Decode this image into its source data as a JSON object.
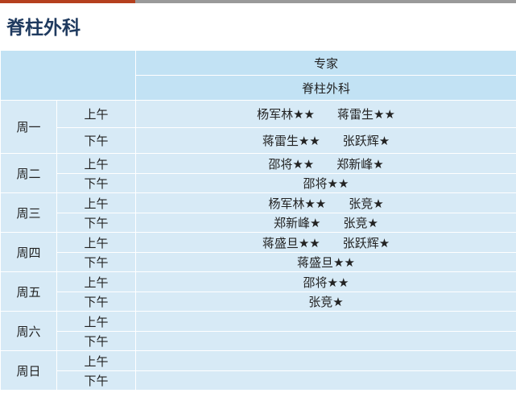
{
  "title": "脊柱外科",
  "header": {
    "experts_label": "专家",
    "dept_label": "脊柱外科"
  },
  "schedule": [
    {
      "day": "周一",
      "am": {
        "label": "上午",
        "doctors": [
          "杨军林★★",
          "蒋雷生★★"
        ]
      },
      "pm": {
        "label": "下午",
        "doctors": [
          "蒋雷生★★",
          "张跃辉★"
        ]
      }
    },
    {
      "day": "周二",
      "am": {
        "label": "上午",
        "doctors": [
          "邵将★★",
          "郑新峰★"
        ]
      },
      "pm": {
        "label": "下午",
        "doctors": [
          "邵将★★"
        ]
      }
    },
    {
      "day": "周三",
      "am": {
        "label": "上午",
        "doctors": [
          "杨军林★★",
          "张竞★"
        ]
      },
      "pm": {
        "label": "下午",
        "doctors": [
          "郑新峰★",
          "张竞★"
        ]
      }
    },
    {
      "day": "周四",
      "am": {
        "label": "上午",
        "doctors": [
          "蒋盛旦★★",
          "张跃辉★"
        ]
      },
      "pm": {
        "label": "下午",
        "doctors": [
          "蒋盛旦★★"
        ]
      }
    },
    {
      "day": "周五",
      "am": {
        "label": "上午",
        "doctors": [
          "邵将★★"
        ]
      },
      "pm": {
        "label": "下午",
        "doctors": [
          "张竞★"
        ]
      }
    },
    {
      "day": "周六",
      "am": {
        "label": "上午",
        "doctors": []
      },
      "pm": {
        "label": "下午",
        "doctors": []
      }
    },
    {
      "day": "周日",
      "am": {
        "label": "上午",
        "doctors": []
      },
      "pm": {
        "label": "下午",
        "doctors": []
      }
    }
  ],
  "colors": {
    "title": "#1f3a5f",
    "header_bg": "#c2e2f4",
    "body_bg": "#d7eaf6",
    "accent_bar": "#b5401e"
  }
}
